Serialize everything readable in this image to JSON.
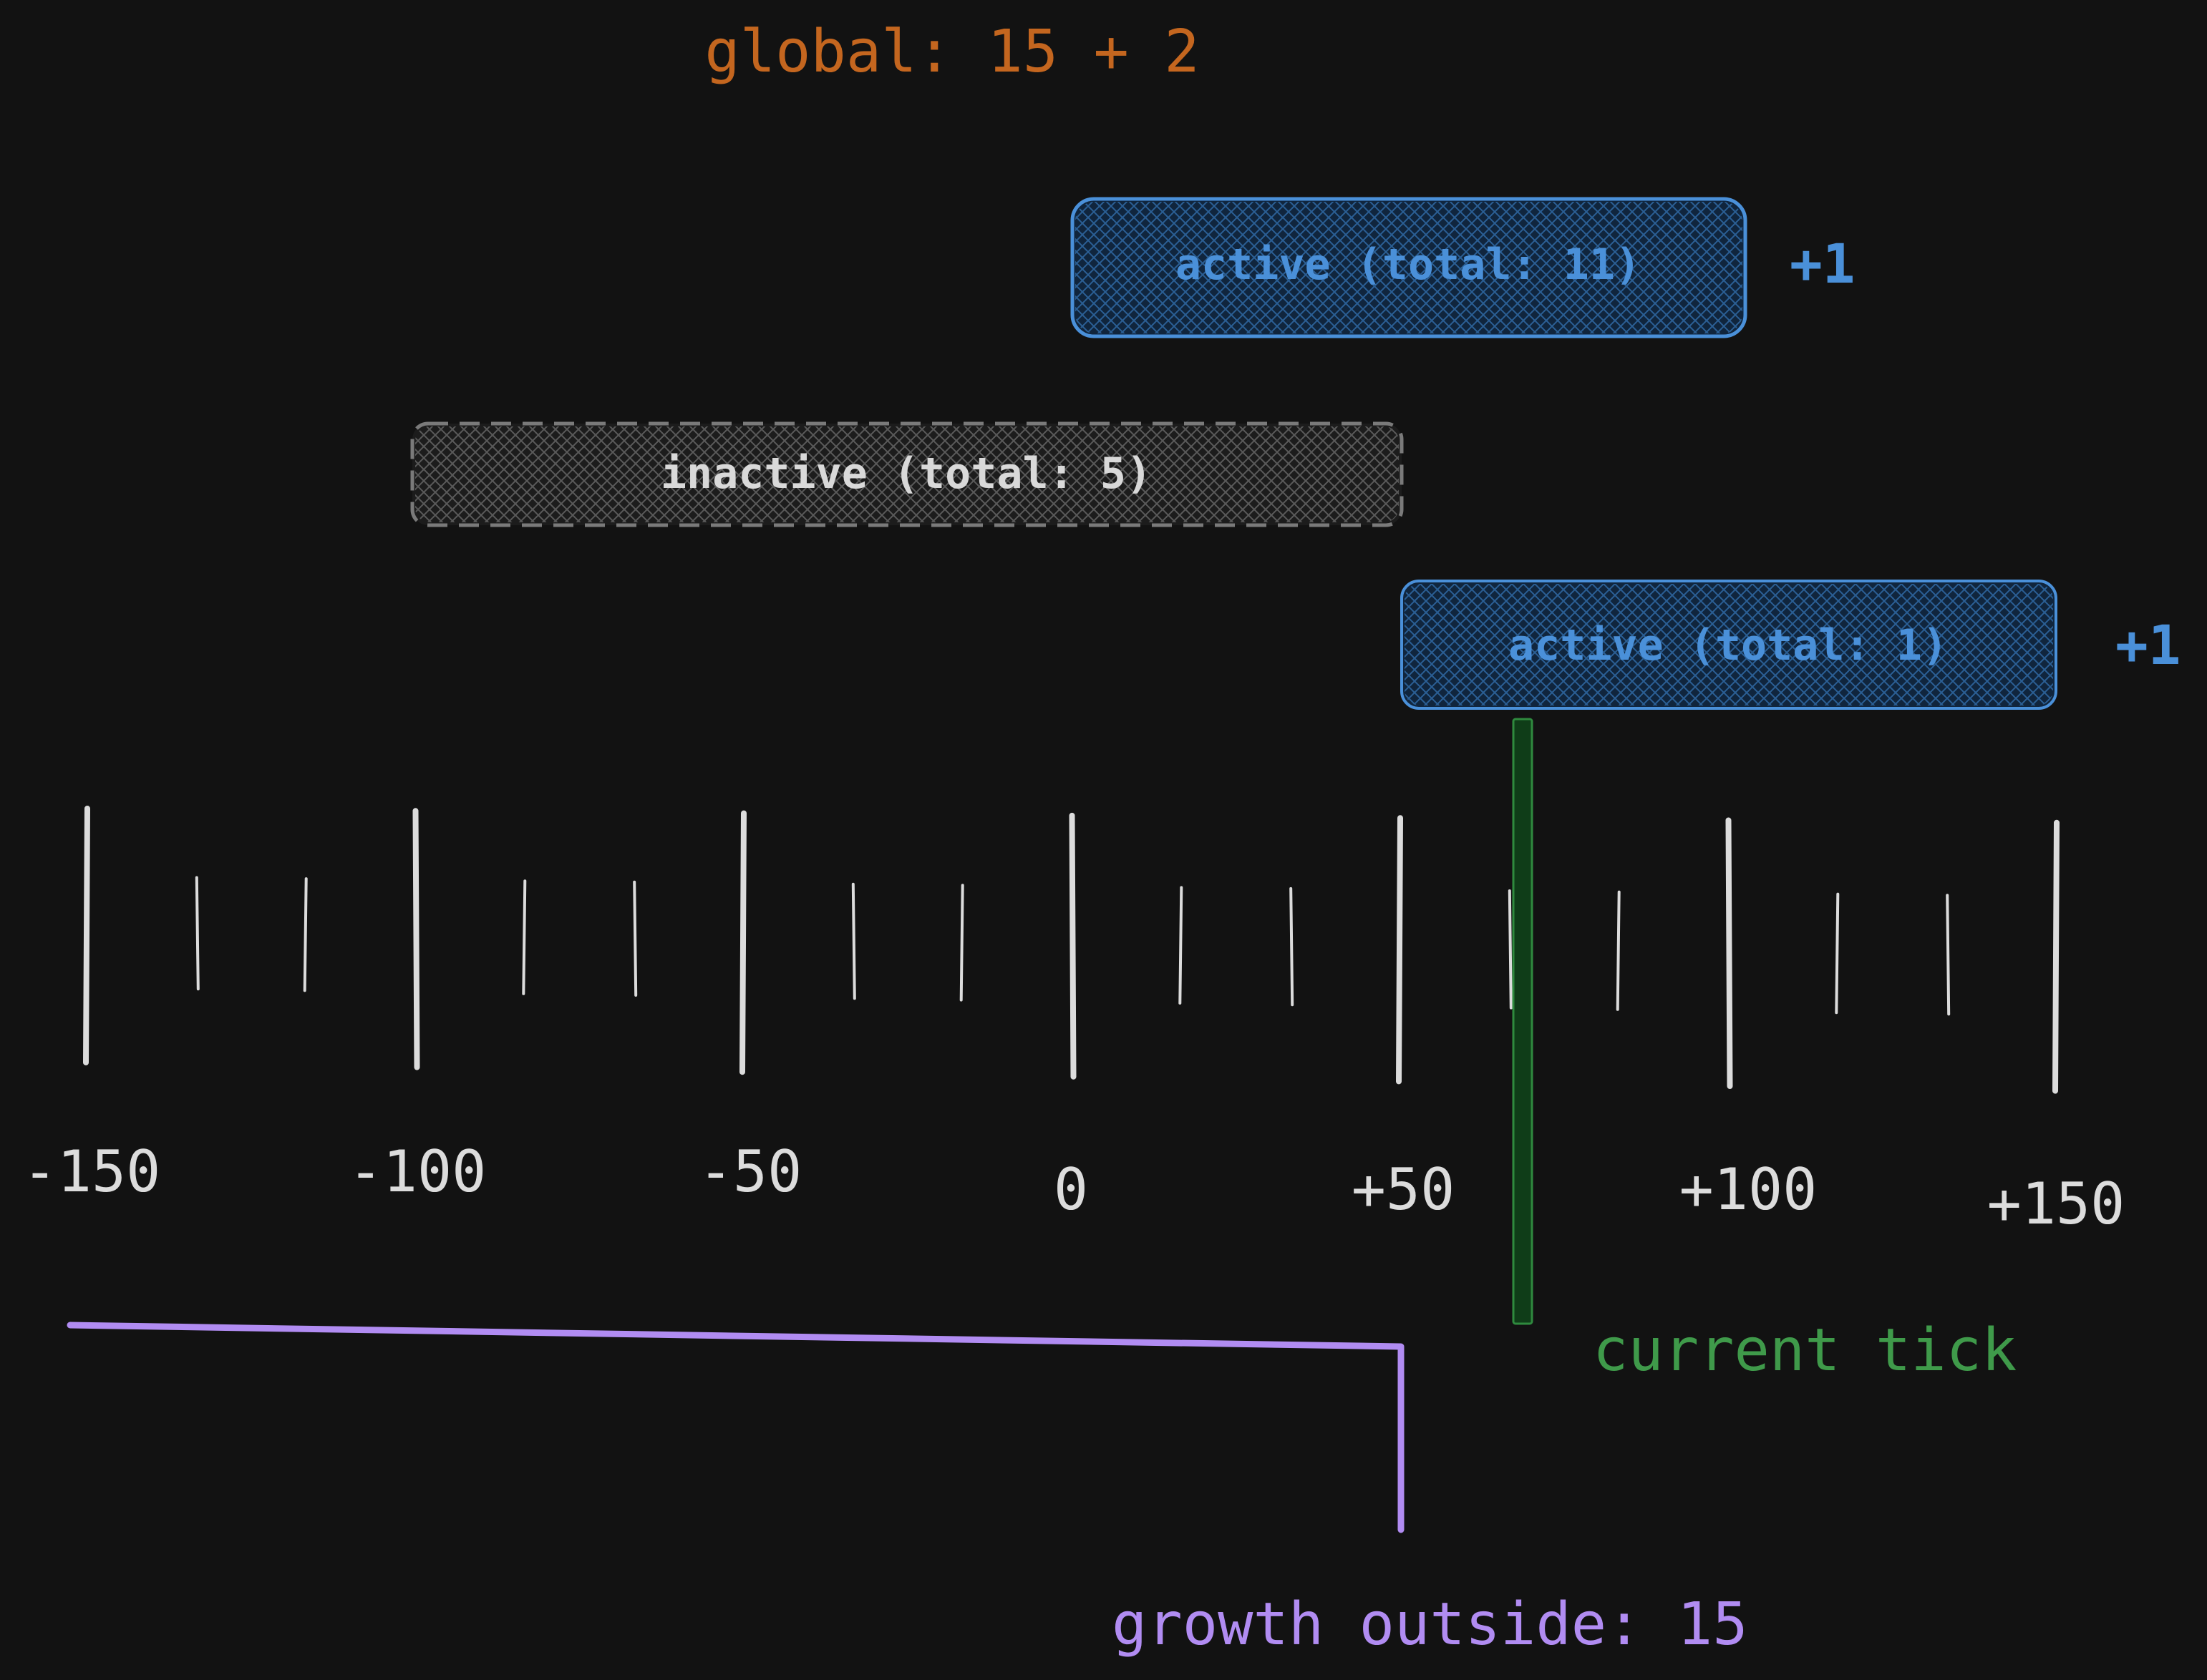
{
  "title": {
    "text": "global: 15 + 2",
    "color": "#c4661f"
  },
  "positions": [
    {
      "label": "active (total: 11)",
      "increment": "+1",
      "state": "active",
      "color": "#4a90d9",
      "lower": 0,
      "upper": 100
    },
    {
      "label": "inactive (total: 5)",
      "increment": "",
      "state": "inactive",
      "color": "#9a9a9a",
      "lower": -100,
      "upper": 50
    },
    {
      "label": "active (total: 1)",
      "increment": "+1",
      "state": "active",
      "color": "#4a90d9",
      "lower": 50,
      "upper": 150
    }
  ],
  "axis": {
    "labels": [
      "-150",
      "-100",
      "-50",
      "0",
      "+50",
      "+100",
      "+150"
    ],
    "min": -150,
    "max": 150,
    "major_step": 50,
    "minor_ticks_per_interval": 2,
    "tick_color": "#dcdcdc"
  },
  "current_tick": {
    "label": "current tick",
    "value": 67,
    "color": "#3f9a4a"
  },
  "growth_outside": {
    "label": "growth outside: 15",
    "from": -150,
    "to": 50,
    "color": "#b18cf2"
  }
}
